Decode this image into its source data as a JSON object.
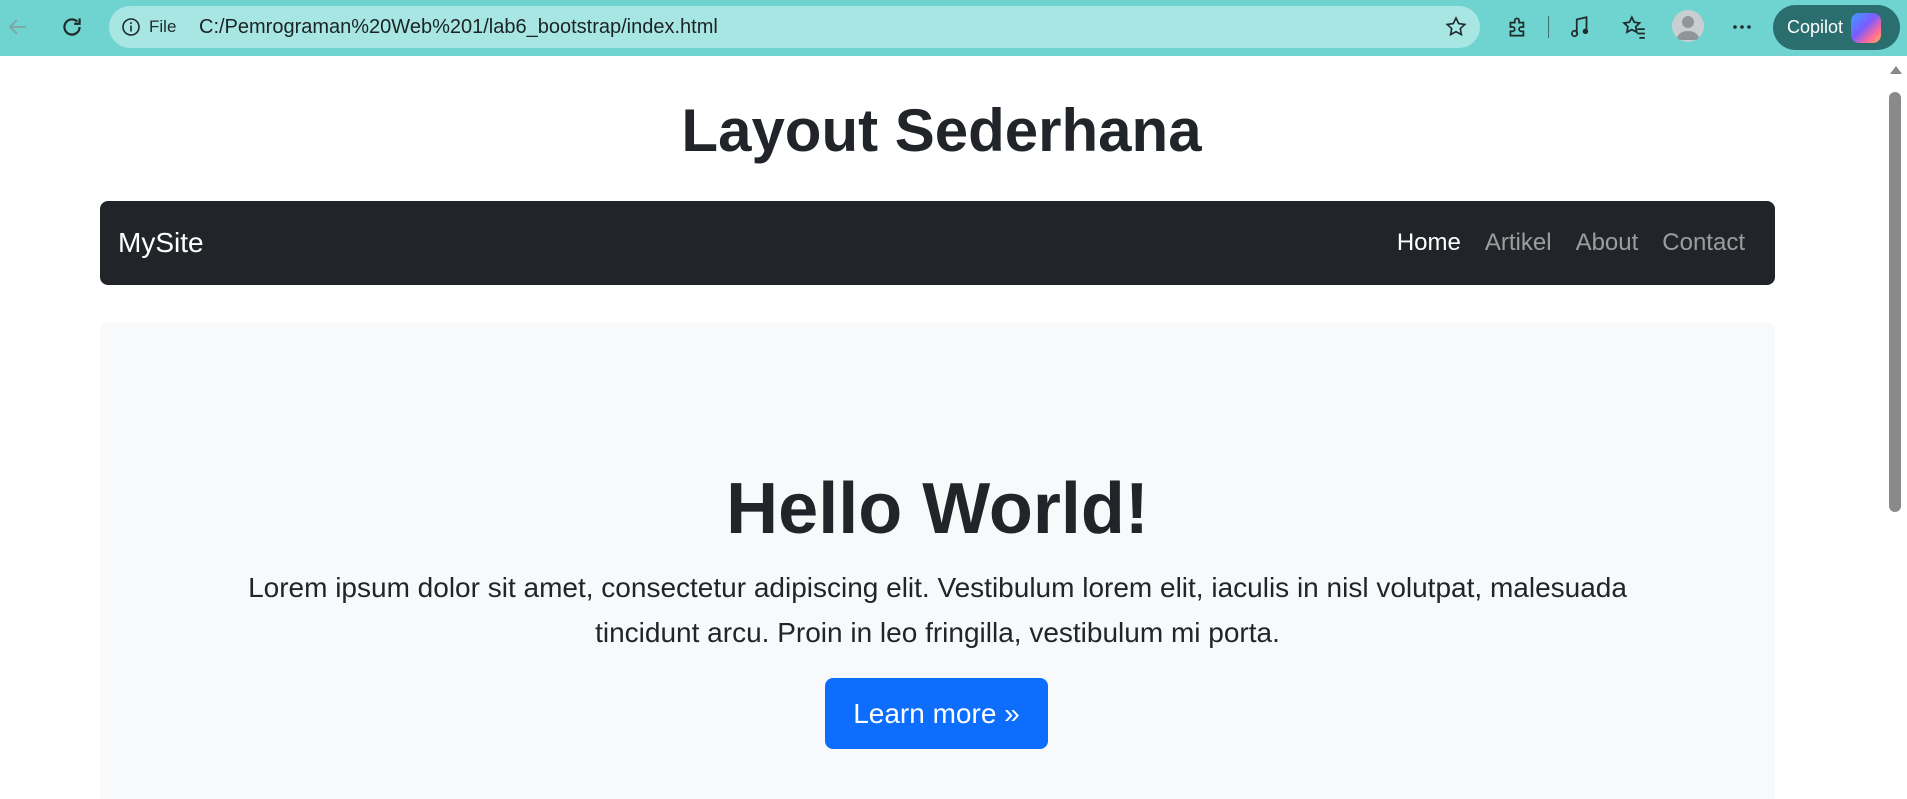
{
  "browser": {
    "url_scheme_label": "File",
    "url": "C:/Pemrograman%20Web%201/lab6_bootstrap/index.html",
    "copilot_label": "Copilot"
  },
  "page": {
    "title": "Layout Sederhana"
  },
  "navbar": {
    "brand": "MySite",
    "links": [
      {
        "label": "Home",
        "active": true
      },
      {
        "label": "Artikel",
        "active": false
      },
      {
        "label": "About",
        "active": false
      },
      {
        "label": "Contact",
        "active": false
      }
    ]
  },
  "hero": {
    "title": "Hello World!",
    "lead": "Lorem ipsum dolor sit amet, consectetur adipiscing elit. Vestibulum lorem elit, iaculis in nisl volutpat, malesuada tincidunt arcu. Proin in leo fringilla, vestibulum mi porta.",
    "button_label": "Learn more »"
  },
  "colors": {
    "chrome_bg": "#6fd3cf",
    "navbar_bg": "#212529",
    "primary": "#0d6efd",
    "jumbotron_bg": "#f8f9fa"
  }
}
